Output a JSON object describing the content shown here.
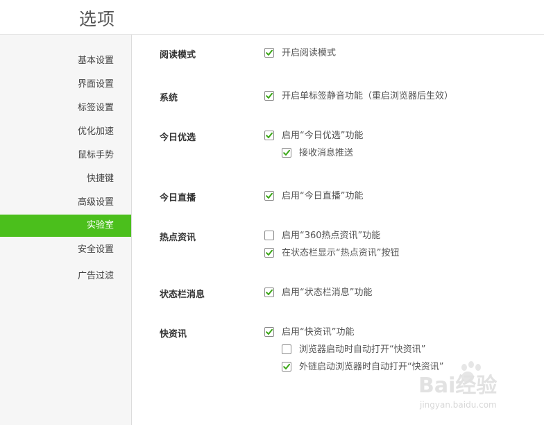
{
  "header": {
    "title": "选项"
  },
  "sidebar": {
    "items": [
      {
        "label": "基本设置",
        "active": false
      },
      {
        "label": "界面设置",
        "active": false
      },
      {
        "label": "标签设置",
        "active": false
      },
      {
        "label": "优化加速",
        "active": false
      },
      {
        "label": "鼠标手势",
        "active": false
      },
      {
        "label": "快捷键",
        "active": false
      },
      {
        "label": "高级设置",
        "active": false
      },
      {
        "label": "实验室",
        "active": true
      },
      {
        "label": "安全设置",
        "active": false
      },
      {
        "label": "广告过滤",
        "active": false
      }
    ]
  },
  "sections": [
    {
      "title": "阅读模式",
      "options": [
        {
          "label": "开启阅读模式",
          "checked": true
        }
      ]
    },
    {
      "title": "系统",
      "options": [
        {
          "label": "开启单标签静音功能（重启浏览器后生效）",
          "checked": true
        }
      ]
    },
    {
      "title": "今日优选",
      "options": [
        {
          "label": "启用“今日优选”功能",
          "checked": true
        },
        {
          "label": "接收消息推送",
          "checked": true
        }
      ]
    },
    {
      "title": "今日直播",
      "options": [
        {
          "label": "启用“今日直播”功能",
          "checked": true
        }
      ]
    },
    {
      "title": "热点资讯",
      "options": [
        {
          "label": "启用“360热点资讯”功能",
          "checked": false
        },
        {
          "label": "在状态栏显示“热点资讯”按钮",
          "checked": true
        }
      ]
    },
    {
      "title": "状态栏消息",
      "options": [
        {
          "label": "启用“状态栏消息”功能",
          "checked": true
        }
      ]
    },
    {
      "title": "快资讯",
      "options": [
        {
          "label": "启用“快资讯”功能",
          "checked": true
        },
        {
          "label": "浏览器启动时自动打开“快资讯”",
          "checked": false
        },
        {
          "label": "外链启动浏览器时自动打开“快资讯”",
          "checked": true
        }
      ]
    }
  ],
  "watermark": {
    "brand": "Bai经验",
    "url": "jingyan.baidu.com"
  },
  "colors": {
    "accent": "#4bbf1c",
    "check": "#3aa616"
  }
}
